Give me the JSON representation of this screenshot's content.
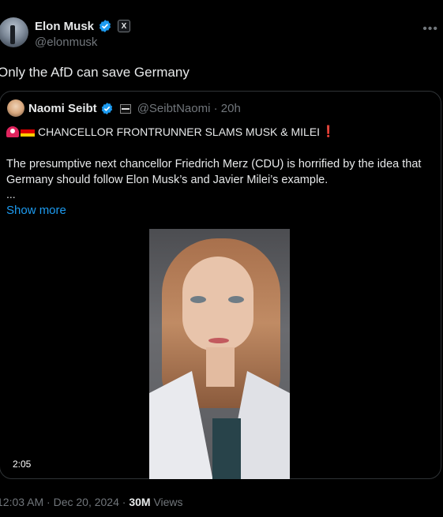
{
  "tweet": {
    "display_name": "Elon Musk",
    "handle": "@elonmusk",
    "badge_label": "X",
    "more_icon": "more-icon",
    "text": "Only the AfD can save Germany"
  },
  "quote": {
    "display_name": "Naomi Seibt",
    "handle_time": "@SeibtNaomi · 20h",
    "headline": "CHANCELLOR FRONTRUNNER SLAMS MUSK & MILEI",
    "headline_suffix": "❗",
    "body_line1": "The presumptive next chancellor Friedrich Merz (CDU) is horrified by the idea that",
    "body_line2": "Germany should follow Elon Musk’s and Javier Milei’s example.",
    "ellipsis": "...",
    "show_more": "Show more",
    "video_duration": "2:05"
  },
  "meta": {
    "time": "12:03 AM · Dec 20, 2024 · ",
    "views_count": "30M",
    "views_label": " Views"
  },
  "colors": {
    "background": "#000000",
    "text": "#e7e9ea",
    "muted": "#71767b",
    "link": "#1d9bf0",
    "verified": "#1d9bf0",
    "border": "#2f3336"
  }
}
